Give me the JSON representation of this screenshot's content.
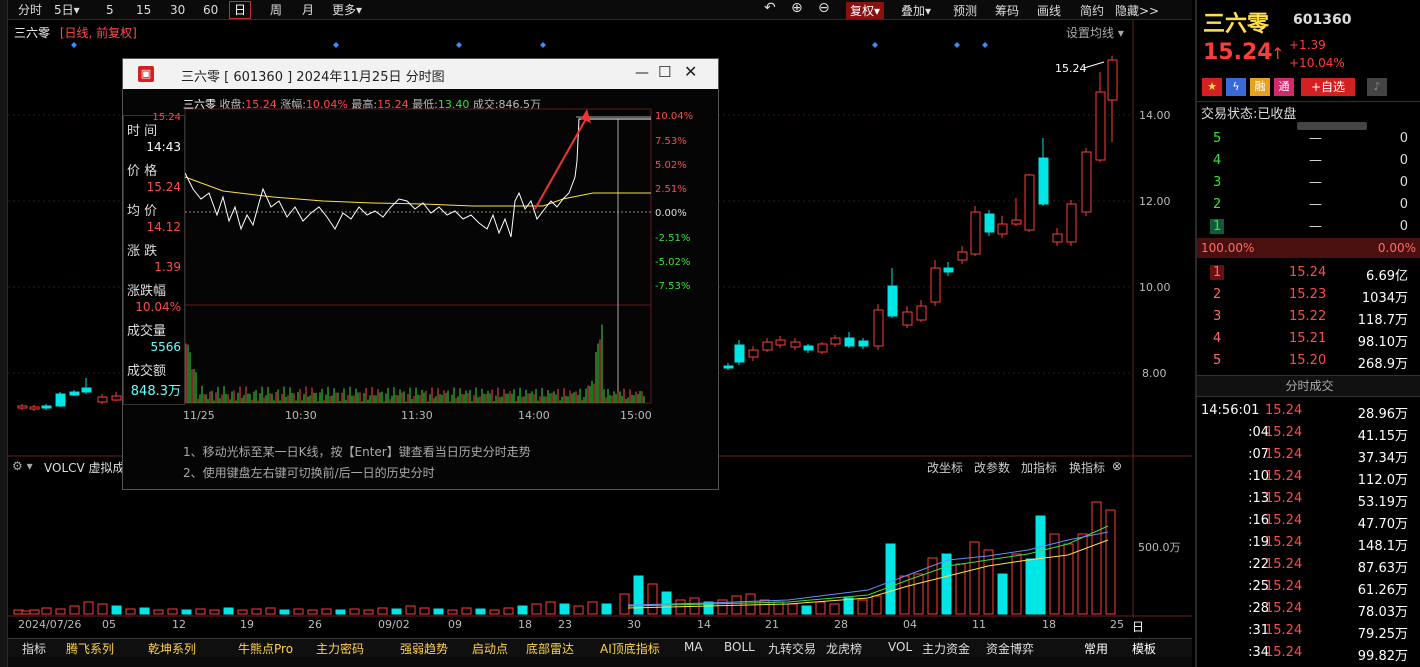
{
  "period_toolbar": {
    "items": [
      "分时",
      "5日",
      "5",
      "15",
      "30",
      "60",
      "日",
      "周",
      "月",
      "更多"
    ],
    "selected": "日"
  },
  "right_toolbar": {
    "fuquan": "复权",
    "items": [
      "叠加",
      "预测",
      "筹码",
      "画线",
      "简约",
      "隐藏>>"
    ]
  },
  "chart_header": {
    "name": "三六零",
    "mode": "[日线, 前复权]",
    "ma_button": "设置均线",
    "last_price_label": "15.24"
  },
  "price_axis": [
    "14.00",
    "12.00",
    "10.00",
    "8.00"
  ],
  "volume_axis": [
    "500.0万"
  ],
  "volume_panel": {
    "title": "VOLCV 虚拟成交",
    "tools": [
      "改坐标",
      "改参数",
      "加指标",
      "换指标"
    ]
  },
  "date_axis": [
    "2024/07/26",
    "05",
    "12",
    "19",
    "26",
    "09/02",
    "09",
    "18",
    "23",
    "30",
    "14",
    "21",
    "28",
    "04",
    "11",
    "18",
    "25"
  ],
  "period_label": "日线",
  "bottom_tabs": [
    "指标",
    "腾飞系列",
    "乾坤系列",
    "牛熊点Pro",
    "主力密码",
    "强弱趋势",
    "启动点",
    "底部雷达",
    "AI顶底指标",
    "MA",
    "BOLL",
    "九转交易",
    "龙虎榜",
    "VOL",
    "主力资金",
    "资金博弈"
  ],
  "bottom_right": [
    "常用",
    "模板"
  ],
  "popup": {
    "title": "三六零  [ 601360 ]  2024年11月25日  分时图",
    "info": {
      "name": "三六零",
      "close_label": "收盘:",
      "close": "15.24",
      "chg_label": "涨幅:",
      "chg": "10.04%",
      "high_label": "最高:",
      "high": "15.24",
      "low_label": "最低:",
      "low": "13.40",
      "vol_label": "成交:",
      "vol": "846.5万"
    },
    "side": {
      "time_label": "时 间",
      "time": "14:43",
      "price_label": "价 格",
      "price": "15.24",
      "avg_label": "均 价",
      "avg": "14.12",
      "change_label": "涨 跌",
      "change": "1.39",
      "pct_label": "涨跌幅",
      "pct": "10.04%",
      "vol_label": "成交量",
      "vol": "5566",
      "amt_label": "成交额",
      "amt": "848.3万",
      "hidden_val": "15.24"
    },
    "pct_axis": [
      "10.04%",
      "7.53%",
      "5.02%",
      "2.51%",
      "0.00%",
      "-2.51%",
      "-5.02%",
      "-7.53%"
    ],
    "time_axis": [
      "11/25",
      "10:30",
      "11:30",
      "14:00",
      "15:00"
    ],
    "tips": [
      "1、移动光标至某一日K线，按【Enter】键查看当日历史分时走势",
      "2、使用键盘左右键可切换前/后一日的历史分时"
    ]
  },
  "quote": {
    "name": "三六零",
    "code": "601360",
    "price": "15.24",
    "arrow": "↑",
    "chg": "+1.39",
    "pct": "+10.04%",
    "badges": [
      "融",
      "通"
    ],
    "add_fav": "+自选",
    "status_label": "交易状态:",
    "status": "已收盘",
    "bids": [
      {
        "lv": "5",
        "p": "—",
        "v": "0"
      },
      {
        "lv": "4",
        "p": "—",
        "v": "0"
      },
      {
        "lv": "3",
        "p": "—",
        "v": "0"
      },
      {
        "lv": "2",
        "p": "—",
        "v": "0"
      },
      {
        "lv": "1",
        "p": "—",
        "v": "0"
      }
    ],
    "ratio_left": "100.00%",
    "ratio_right": "0.00%",
    "asks": [
      {
        "lv": "1",
        "p": "15.24",
        "v": "6.69亿"
      },
      {
        "lv": "2",
        "p": "15.23",
        "v": "1034万"
      },
      {
        "lv": "3",
        "p": "15.22",
        "v": "118.7万"
      },
      {
        "lv": "4",
        "p": "15.21",
        "v": "98.10万"
      },
      {
        "lv": "5",
        "p": "15.20",
        "v": "268.9万"
      }
    ],
    "trades_title": "分时成交",
    "trades": [
      {
        "t": "14:56:01",
        "p": "15.24",
        "v": "28.96万"
      },
      {
        "t": ":04",
        "p": "15.24",
        "v": "41.15万"
      },
      {
        "t": ":07",
        "p": "15.24",
        "v": "37.34万"
      },
      {
        "t": ":10",
        "p": "15.24",
        "v": "112.0万"
      },
      {
        "t": ":13",
        "p": "15.24",
        "v": "53.19万"
      },
      {
        "t": ":16",
        "p": "15.24",
        "v": "47.70万"
      },
      {
        "t": ":19",
        "p": "15.24",
        "v": "148.1万"
      },
      {
        "t": ":22",
        "p": "15.24",
        "v": "87.63万"
      },
      {
        "t": ":25",
        "p": "15.24",
        "v": "61.26万"
      },
      {
        "t": ":28",
        "p": "15.24",
        "v": "78.03万"
      },
      {
        "t": ":31",
        "p": "15.24",
        "v": "79.25万"
      },
      {
        "t": ":34",
        "p": "15.24",
        "v": "99.82万"
      }
    ]
  },
  "colors": {
    "up": "#ff3b3b",
    "down": "#00e5e5",
    "ma5": "#ffffff",
    "ma10": "#ffe04a",
    "ma20": "#3ce03c"
  }
}
